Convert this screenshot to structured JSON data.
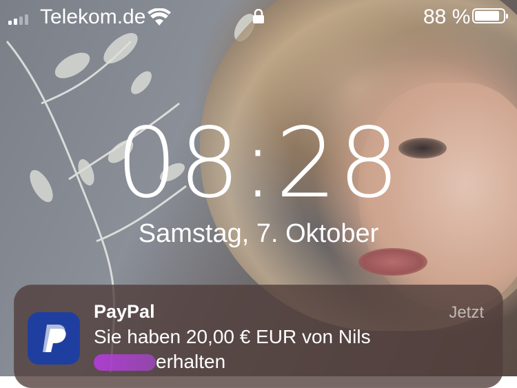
{
  "status_bar": {
    "carrier": "Telekom.de",
    "battery_percent": "88 %",
    "battery_level": 0.88,
    "icons": [
      "signal-icon",
      "wifi-icon",
      "lock-icon",
      "battery-icon"
    ]
  },
  "lock_screen": {
    "time": "08:28",
    "date": "Samstag, 7. Oktober"
  },
  "notification": {
    "app_name": "PayPal",
    "time_ago": "Jetzt",
    "message_line1": "Sie haben 20,00 € EUR von Nils",
    "message_line2_suffix": "erhalten",
    "icon": "paypal-app-icon",
    "accent_color": "#1f3fa0"
  }
}
